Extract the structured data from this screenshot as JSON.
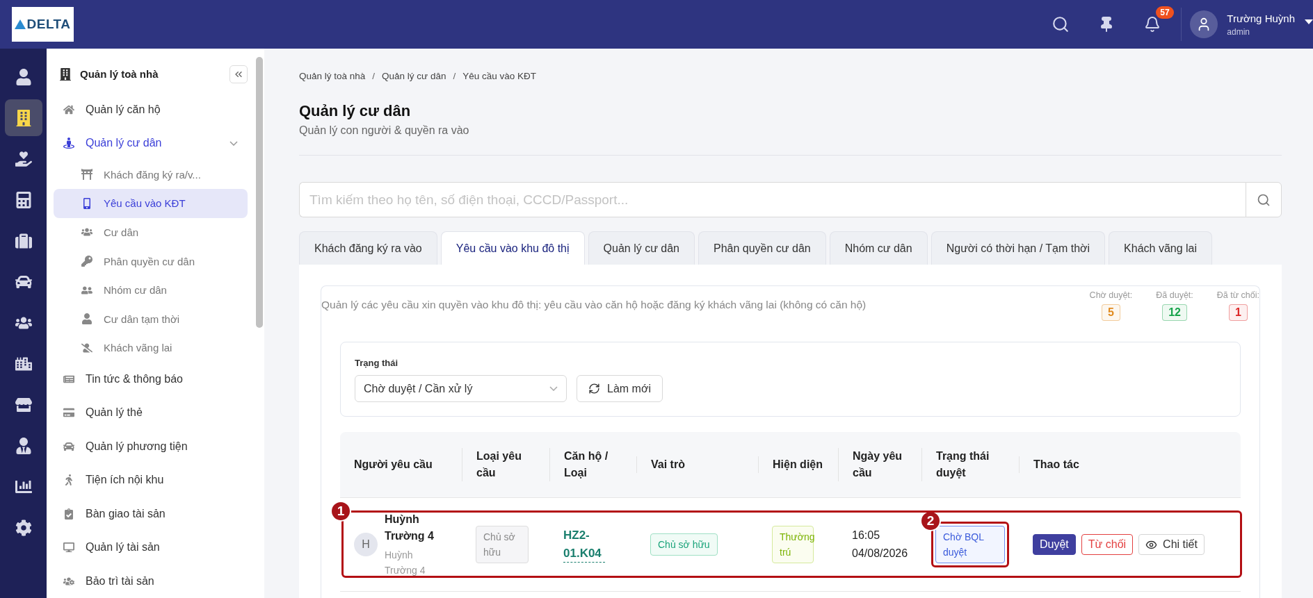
{
  "top_bar": {
    "logo": "DELTA",
    "notification_count": "57",
    "user": {
      "name": "Trường Huỳnh",
      "role": "admin"
    }
  },
  "rail": [
    {
      "kind": "user",
      "selected": false
    },
    {
      "kind": "building",
      "selected": true
    },
    {
      "kind": "care",
      "selected": false
    },
    {
      "kind": "calculator",
      "selected": false
    },
    {
      "kind": "briefcase",
      "selected": false
    },
    {
      "kind": "car",
      "selected": false
    },
    {
      "kind": "users",
      "selected": false
    },
    {
      "kind": "city",
      "selected": false
    },
    {
      "kind": "store",
      "selected": false
    },
    {
      "kind": "staff",
      "selected": false
    },
    {
      "kind": "chart",
      "selected": false
    },
    {
      "kind": "settings",
      "selected": false
    }
  ],
  "sidebar": {
    "title": "Quản lý toà nhà",
    "items": [
      {
        "label": "Quản lý căn hộ",
        "kind": "home",
        "selected": false
      },
      {
        "label": "Quản lý cư dân",
        "kind": "resident",
        "selected": true,
        "expanded": true,
        "children": [
          {
            "label": "Khách đăng ký ra/v...",
            "kind": "gate",
            "selected": false
          },
          {
            "label": "Yêu cầu vào KĐT",
            "kind": "phone",
            "selected": true
          },
          {
            "label": "Cư dân",
            "kind": "users",
            "selected": false
          },
          {
            "label": "Phân quyền cư dân",
            "kind": "key",
            "selected": false
          },
          {
            "label": "Nhóm cư dân",
            "kind": "group",
            "selected": false
          },
          {
            "label": "Cư dân tạm thời",
            "kind": "user",
            "selected": false
          },
          {
            "label": "Khách vãng lai",
            "kind": "guest",
            "selected": false
          }
        ]
      },
      {
        "label": "Tin tức & thông báo",
        "kind": "news",
        "selected": false
      },
      {
        "label": "Quản lý thẻ",
        "kind": "card",
        "selected": false
      },
      {
        "label": "Quản lý phương tiện",
        "kind": "car",
        "selected": false
      },
      {
        "label": "Tiện ích nội khu",
        "kind": "walk",
        "selected": false
      },
      {
        "label": "Bàn giao tài sản",
        "kind": "clipboard",
        "selected": false
      },
      {
        "label": "Quản lý tài sản",
        "kind": "desktop",
        "selected": false
      },
      {
        "label": "Bảo trì tài sản",
        "kind": "team",
        "selected": false
      }
    ]
  },
  "breadcrumb": [
    "Quản lý toà nhà",
    "Quản lý cư dân",
    "Yêu cầu vào KĐT"
  ],
  "breadcrumb_separator": "/",
  "page": {
    "title": "Quản lý cư dân",
    "subtitle": "Quản lý con người & quyền ra vào"
  },
  "search": {
    "placeholder": "Tìm kiếm theo họ tên, số điện thoại, CCCD/Passport..."
  },
  "tabs": [
    {
      "label": "Khách đăng ký ra vào",
      "selected": false
    },
    {
      "label": "Yêu cầu vào khu đô thị",
      "selected": true
    },
    {
      "label": "Quản lý cư dân",
      "selected": false
    },
    {
      "label": "Phân quyền cư dân",
      "selected": false
    },
    {
      "label": "Nhóm cư dân",
      "selected": false
    },
    {
      "label": "Người có thời hạn / Tạm thời",
      "selected": false
    },
    {
      "label": "Khách vãng lai",
      "selected": false
    }
  ],
  "panel": {
    "description": "Quản lý các yêu cầu xin quyền vào khu đô thị: yêu cầu vào căn hộ hoặc đăng ký khách vãng lai (không có căn hộ)",
    "stats": [
      {
        "label": "Chờ duyệt:",
        "value": "5",
        "color": "#e08a1e"
      },
      {
        "label": "Đã duyệt:",
        "value": "12",
        "color": "#16a34a"
      },
      {
        "label": "Đã từ chối:",
        "value": "1",
        "color": "#dc2626"
      }
    ],
    "filter": {
      "label": "Trạng thái",
      "value": "Chờ duyệt / Cần xử lý",
      "refresh": "Làm mới"
    },
    "table": {
      "columns": [
        "Người yêu cầu",
        "Loại yêu cầu",
        "Căn hộ / Loại",
        "Vai trò",
        "Hiện diện",
        "Ngày yêu cầu",
        "Trạng thái duyệt",
        "Thao tác"
      ],
      "rows": [
        {
          "avatar": "H",
          "name": "Huỳnh Trường 4",
          "sub": "Huỳnh Trường 4",
          "type": "Chủ sở hữu",
          "unit": "HZ2-01.K04",
          "role": "Chủ sở hữu",
          "residency": "Thường trú",
          "date": "16:05 04/08/2026",
          "status": "Chờ BQL duyệt",
          "actions": [
            {
              "label": "Duyệt",
              "kind": "approve"
            },
            {
              "label": "Từ chối",
              "kind": "reject"
            },
            {
              "label": "Chi tiết",
              "kind": "detail"
            }
          ]
        }
      ]
    }
  },
  "annotations": [
    {
      "label": "1"
    },
    {
      "label": "2"
    }
  ]
}
